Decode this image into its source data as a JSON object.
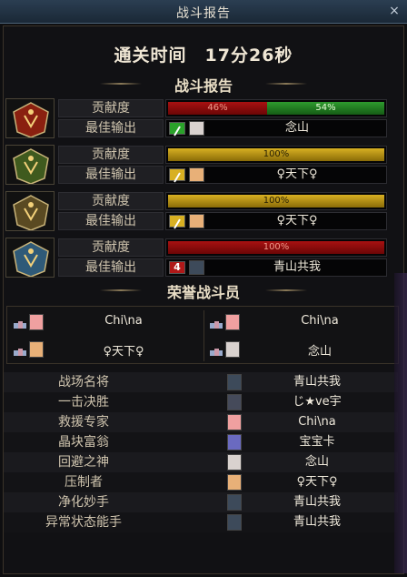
{
  "window": {
    "title": "战斗报告",
    "close_label": "×"
  },
  "clear_time": "通关时间　17分26秒",
  "report_header": "战斗报告",
  "players": [
    {
      "contribution_label": "贡献度",
      "best_output_label": "最佳输出",
      "bar_color": "red-green",
      "segments": [
        {
          "label": "46%",
          "value": 46,
          "color": "#a81111"
        },
        {
          "label": "54%",
          "value": 54,
          "color": "#2e9b2e"
        }
      ],
      "weapon_color": "#2aa22a",
      "portrait_color": "#d9d2cf",
      "name": "念山",
      "avatar_color": "#8a2010"
    },
    {
      "contribution_label": "贡献度",
      "best_output_label": "最佳输出",
      "bar_color": "gold",
      "segments": [
        {
          "label": "100%",
          "value": 100,
          "color": "#d8b022"
        }
      ],
      "weapon_color": "#d8b022",
      "portrait_color": "#e8b078",
      "name": "♀天下♀",
      "avatar_color": "#3f5a1e"
    },
    {
      "contribution_label": "贡献度",
      "best_output_label": "最佳输出",
      "bar_color": "gold",
      "segments": [
        {
          "label": "100%",
          "value": 100,
          "color": "#d8b022"
        }
      ],
      "weapon_color": "#d8b022",
      "portrait_color": "#e8b078",
      "name": "♀天下♀",
      "avatar_color": "#5a4a22"
    },
    {
      "contribution_label": "贡献度",
      "best_output_label": "最佳输出",
      "bar_color": "red",
      "segments": [
        {
          "label": "100%",
          "value": 100,
          "color": "#a81111"
        }
      ],
      "weapon_color": "#b01818",
      "portrait_color": "#3d4a5a",
      "weapon_text": "4",
      "name": "青山共我",
      "avatar_color": "#2f5a78"
    }
  ],
  "honor_header": "荣誉战斗员",
  "honor": [
    {
      "name": "Chi\\na",
      "portrait_color": "#f0a0a0"
    },
    {
      "name": "Chi\\na",
      "portrait_color": "#f0a0a0"
    },
    {
      "name": "♀天下♀",
      "portrait_color": "#e8b078"
    },
    {
      "name": "念山",
      "portrait_color": "#d9d2cf"
    }
  ],
  "awards": [
    {
      "title": "战场名将",
      "player": "青山共我",
      "portrait_color": "#3d4a5a"
    },
    {
      "title": "一击决胜",
      "player": "じ★ve宇",
      "portrait_color": "#454a5a"
    },
    {
      "title": "救援专家",
      "player": "Chi\\na",
      "portrait_color": "#f0a0a0"
    },
    {
      "title": "晶块富翁",
      "player": "宝宝卡",
      "portrait_color": "#6a6ac0"
    },
    {
      "title": "回避之神",
      "player": "念山",
      "portrait_color": "#d9d2cf"
    },
    {
      "title": "压制者",
      "player": "♀天下♀",
      "portrait_color": "#e8b078"
    },
    {
      "title": "净化妙手",
      "player": "青山共我",
      "portrait_color": "#3d4a5a"
    },
    {
      "title": "异常状态能手",
      "player": "青山共我",
      "portrait_color": "#3d4a5a"
    }
  ]
}
